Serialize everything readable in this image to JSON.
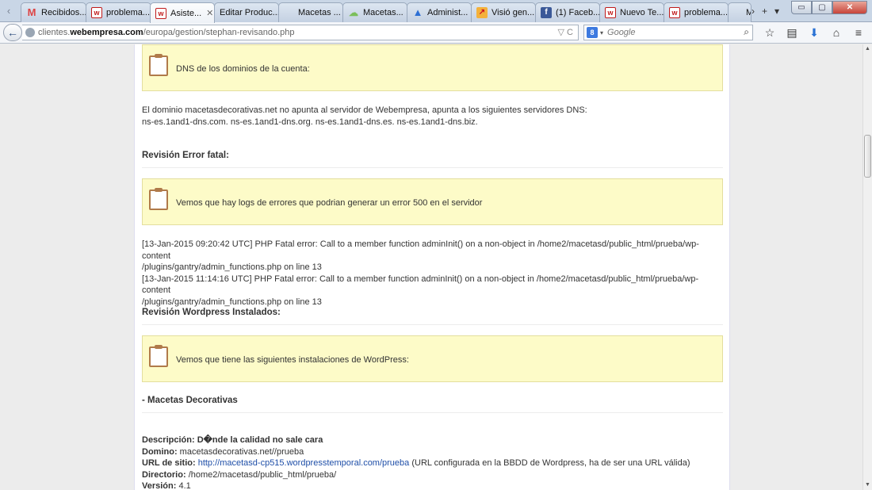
{
  "tabs": [
    {
      "label": "Recibidos...",
      "icon": "gmail-icon",
      "glyph": "M"
    },
    {
      "label": "problema...",
      "icon": "webempresa-icon",
      "glyph": "w"
    },
    {
      "label": "Asiste...",
      "icon": "webempresa-icon",
      "glyph": "w",
      "active": true,
      "close": "✕"
    },
    {
      "label": "Editar Produc...",
      "icon": "",
      "glyph": ""
    },
    {
      "label": "Macetas ...",
      "icon": "",
      "glyph": ""
    },
    {
      "label": "Macetas...",
      "icon": "cloud-icon",
      "glyph": "☁"
    },
    {
      "label": "Administ...",
      "icon": "adwords-icon",
      "glyph": "▲"
    },
    {
      "label": "Visió gen...",
      "icon": "analytics-icon",
      "glyph": "↗"
    },
    {
      "label": "(1) Faceb...",
      "icon": "facebook-icon",
      "glyph": "f"
    },
    {
      "label": "Nuevo Te...",
      "icon": "webempresa-icon",
      "glyph": "w"
    },
    {
      "label": "problema...",
      "icon": "webempresa-icon",
      "glyph": "w"
    },
    {
      "label": "M",
      "icon": "",
      "glyph": ""
    }
  ],
  "tab_tools": {
    "scroll_right": "›",
    "new_tab": "+",
    "list": "▾",
    "scroll_left": "‹"
  },
  "window": {
    "minimize": "▭",
    "maximize": "▢",
    "close": "✕"
  },
  "nav": {
    "back": "←",
    "url_pre": "clientes.",
    "url_host": "webempresa.com",
    "url_path": "/europa/gestion/stephan-revisando.php",
    "url_controls": "▽  C",
    "search_engine": "8",
    "search_caret": "▾",
    "search_placeholder": "Google",
    "search_mag": "⌕",
    "icons": {
      "bookmark": "☆",
      "reader": "▤",
      "download": "⬇",
      "home": "⌂",
      "menu": "≡"
    }
  },
  "content": {
    "notice_dns": "DNS de los dominios de la cuenta:",
    "dns_line1": "El dominio macetasdecorativas.net no apunta al servidor de Webempresa, apunta a los siguientes servidores DNS:",
    "dns_line2": "ns-es.1and1-dns.com. ns-es.1and1-dns.org. ns-es.1and1-dns.es. ns-es.1and1-dns.biz.",
    "head_error": "Revisión Error fatal:",
    "notice_error": "Vemos que hay logs de errores que podrian generar un error 500 en el servidor",
    "log1a": "[13-Jan-2015 09:20:42 UTC] PHP Fatal error: Call to a member function adminInit() on a non-object in /home2/macetasd/public_html/prueba/wp-content",
    "log1b": "/plugins/gantry/admin_functions.php on line 13",
    "log2a": "[13-Jan-2015 11:14:16 UTC] PHP Fatal error: Call to a member function adminInit() on a non-object in /home2/macetasd/public_html/prueba/wp-content",
    "log2b": "/plugins/gantry/admin_functions.php on line 13",
    "head_wp": "Revisión Wordpress Instalados:",
    "notice_wp": "Vemos que tiene las siguientes instalaciones de WordPress:",
    "head_site": "- Macetas Decorativas",
    "desc_label": "Descripción:",
    "desc_value": "D�nde la calidad no sale cara",
    "domain_label": "Domino:",
    "domain_value": "macetasdecorativas.net//prueba",
    "url_label": "URL de sitio:",
    "url_value": "http://macetasd-cp515.wordpresstemporal.com/prueba",
    "url_note": "(URL configurada en la BBDD de Wordpress, ha de ser una URL válida)",
    "dir_label": "Directorio:",
    "dir_value": "/home2/macetasd/public_html/prueba/",
    "ver_label": "Versión:",
    "ver_value": "4.1"
  },
  "scrollbar": {
    "up": "▲",
    "down": "▼"
  }
}
